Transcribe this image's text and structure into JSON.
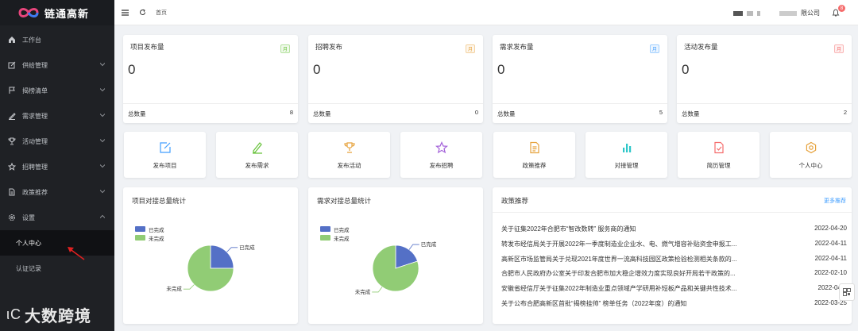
{
  "brand": {
    "name": "链通高新"
  },
  "watermark": {
    "text": "大数跨境",
    "mark": "ιC"
  },
  "sidebar": {
    "items": [
      {
        "label": "工作台",
        "icon": "home-icon"
      },
      {
        "label": "供给管理",
        "icon": "edit-icon"
      },
      {
        "label": "揭榜清单",
        "icon": "flag-icon"
      },
      {
        "label": "需求管理",
        "icon": "pen-icon"
      },
      {
        "label": "活动管理",
        "icon": "trophy-icon"
      },
      {
        "label": "招聘管理",
        "icon": "star-icon"
      },
      {
        "label": "政策推荐",
        "icon": "document-icon"
      },
      {
        "label": "设置",
        "icon": "gear-icon"
      }
    ],
    "sub": [
      {
        "label": "个人中心",
        "active": true
      },
      {
        "label": "认证记录",
        "active": false
      }
    ]
  },
  "topbar": {
    "breadcrumb": "首页",
    "company": "限公司",
    "notifications": "8"
  },
  "stats": [
    {
      "title": "项目发布量",
      "tag": "月",
      "tag_color": "#67c23a",
      "value": "0",
      "footer_label": "总数量",
      "total": "8"
    },
    {
      "title": "招聘发布",
      "tag": "月",
      "tag_color": "#e6a23c",
      "value": "0",
      "footer_label": "总数量",
      "total": "0"
    },
    {
      "title": "需求发布量",
      "tag": "月",
      "tag_color": "#409eff",
      "value": "0",
      "footer_label": "总数量",
      "total": "5"
    },
    {
      "title": "活动发布量",
      "tag": "月",
      "tag_color": "#f56c6c",
      "value": "0",
      "footer_label": "总数量",
      "total": "2"
    }
  ],
  "quick": [
    {
      "label": "发布项目",
      "icon": "edit-square-icon",
      "color": "#409eff"
    },
    {
      "label": "发布需求",
      "icon": "pen-icon",
      "color": "#67c23a"
    },
    {
      "label": "发布活动",
      "icon": "trophy-icon",
      "color": "#e6a23c"
    },
    {
      "label": "发布招聘",
      "icon": "star-icon",
      "color": "#a361d9"
    },
    {
      "label": "政策推荐",
      "icon": "document-icon",
      "color": "#e6a23c"
    },
    {
      "label": "对接管理",
      "icon": "bar-chart-icon",
      "color": "#2ec7c9"
    },
    {
      "label": "简历管理",
      "icon": "checked-file-icon",
      "color": "#f56c6c"
    },
    {
      "label": "个人中心",
      "icon": "gear-icon",
      "color": "#e6a23c"
    }
  ],
  "charts": [
    {
      "title": "项目对接总量统计",
      "legend": [
        "已完成",
        "未完成"
      ],
      "slice_labels": [
        "已完成",
        "未完成"
      ],
      "chart_data": {
        "type": "pie",
        "categories": [
          "已完成",
          "未完成"
        ],
        "values": [
          1,
          3
        ],
        "colors": [
          "#5470c6",
          "#91cc75"
        ]
      }
    },
    {
      "title": "需求对接总量统计",
      "legend": [
        "已完成",
        "未完成"
      ],
      "slice_labels": [
        "已完成",
        "未完成"
      ],
      "chart_data": {
        "type": "pie",
        "categories": [
          "已完成",
          "未完成"
        ],
        "values": [
          1,
          4
        ],
        "colors": [
          "#5470c6",
          "#91cc75"
        ]
      }
    }
  ],
  "policy": {
    "title": "政策推荐",
    "more": "更多推荐",
    "rows": [
      {
        "text": "关于征集2022年合肥市“智改数转” 服务商的通知",
        "date": "2022-04-20"
      },
      {
        "text": "转发市经信局关于开展2022年一季度制造业企业水、电、燃气增容补贴资金申报工...",
        "date": "2022-04-11"
      },
      {
        "text": "高新区市场监管局关于兑现2021年度世界一流高科技园区政策检验检测相关条款的...",
        "date": "2022-04-11"
      },
      {
        "text": "合肥市人民政府办公室关于印发合肥市加大稳企增效力度实现良好开局若干政策的...",
        "date": "2022-02-10"
      },
      {
        "text": "安徽省经信厅关于征集2022年制造业重点领域产学研用补短板产品和关键共性技术...",
        "date": "2022-04-0"
      },
      {
        "text": "关于公布合肥高新区首批“揭榜挂帅” 榜单任务（2022年度）的通知",
        "date": "2022-03-25"
      }
    ]
  }
}
